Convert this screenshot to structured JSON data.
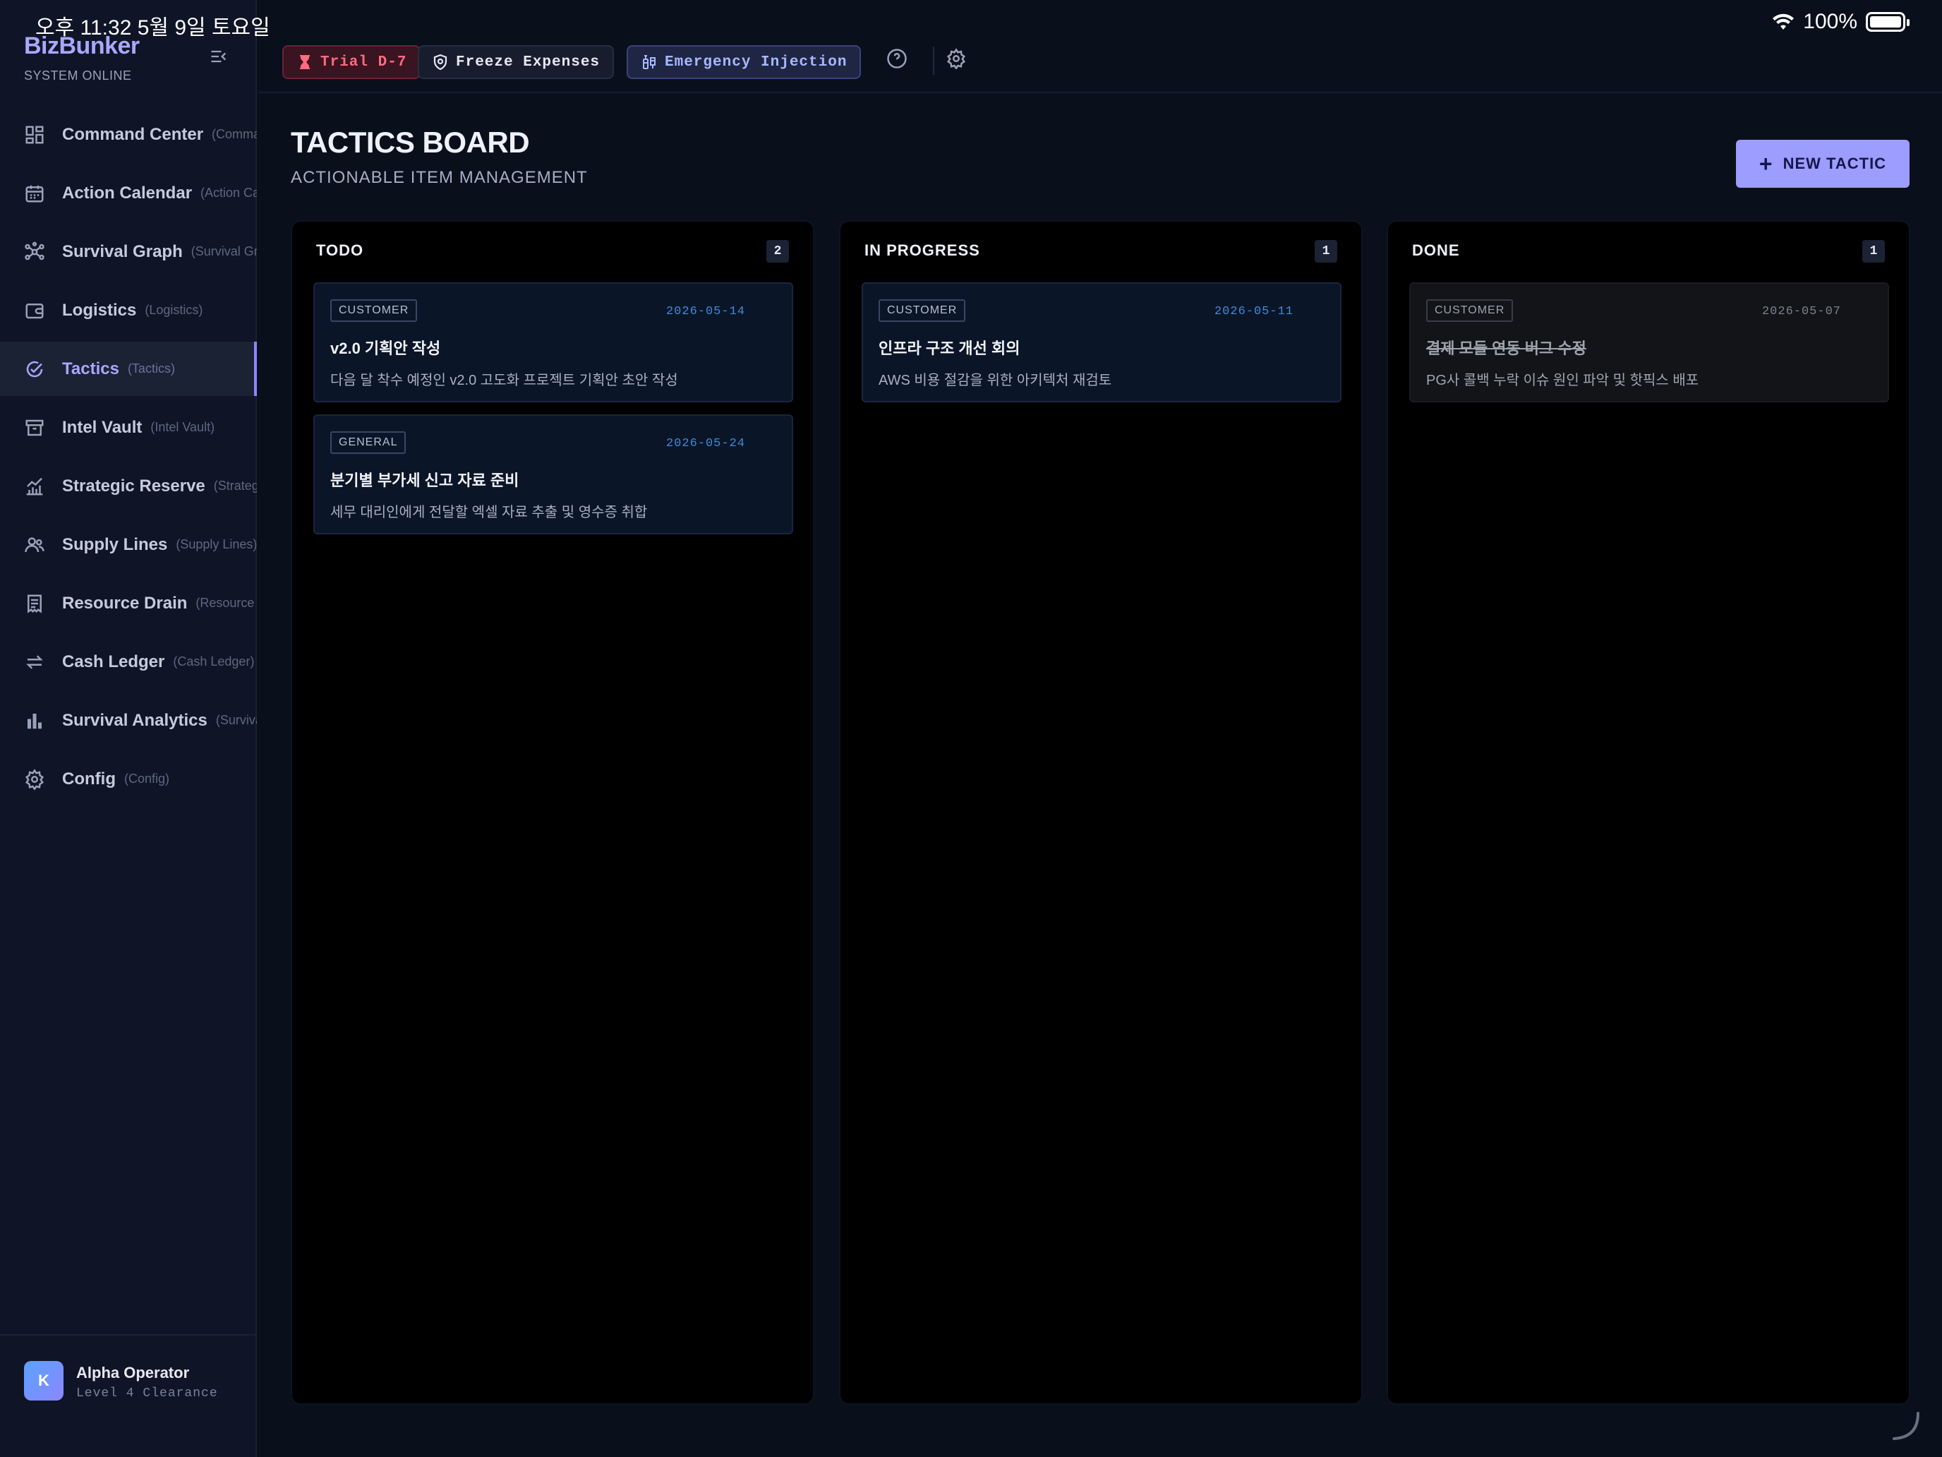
{
  "status_bar": {
    "time": "오후 11:32   5월 9일 토요일",
    "battery": "100%"
  },
  "sidebar": {
    "brand": "BizBunker",
    "status": "SYSTEM ONLINE",
    "items": [
      {
        "label": "Command Center",
        "sub": "(Command Center)",
        "icon": "grid-icon"
      },
      {
        "label": "Action Calendar",
        "sub": "(Action Calendar)",
        "icon": "calendar-icon"
      },
      {
        "label": "Survival Graph",
        "sub": "(Survival Graph)",
        "icon": "graph-icon"
      },
      {
        "label": "Logistics",
        "sub": "(Logistics)",
        "icon": "wallet-icon"
      },
      {
        "label": "Tactics",
        "sub": "(Tactics)",
        "icon": "check-circle-icon",
        "active": true
      },
      {
        "label": "Intel Vault",
        "sub": "(Intel Vault)",
        "icon": "archive-icon"
      },
      {
        "label": "Strategic Reserve",
        "sub": "(Strategic Reserve)",
        "icon": "chart-line-icon"
      },
      {
        "label": "Supply Lines",
        "sub": "(Supply Lines)",
        "icon": "users-icon"
      },
      {
        "label": "Resource Drain",
        "sub": "(Resource Drain)",
        "icon": "receipt-icon"
      },
      {
        "label": "Cash Ledger",
        "sub": "(Cash Ledger)",
        "icon": "swap-icon"
      },
      {
        "label": "Survival Analytics",
        "sub": "(Survival Analytics)",
        "icon": "bar-chart-icon"
      },
      {
        "label": "Config",
        "sub": "(Config)",
        "icon": "gear-icon"
      }
    ],
    "user": {
      "initial": "K",
      "name": "Alpha Operator",
      "level": "Level 4 Clearance"
    }
  },
  "topbar": {
    "trial": "Trial D-7",
    "freeze": "Freeze Expenses",
    "emergency": "Emergency Injection"
  },
  "main": {
    "title": "TACTICS BOARD",
    "subtitle": "ACTIONABLE ITEM MANAGEMENT",
    "new_button": "NEW TACTIC",
    "columns": [
      {
        "title": "TODO",
        "count": "2",
        "cards": [
          {
            "tag": "CUSTOMER",
            "date": "2026-05-14",
            "title": "v2.0 기획안 작성",
            "desc": "다음 달 착수 예정인 v2.0 고도화 프로젝트 기획안 초안 작성"
          },
          {
            "tag": "GENERAL",
            "date": "2026-05-24",
            "title": "분기별 부가세 신고 자료 준비",
            "desc": "세무 대리인에게 전달할 엑셀 자료 추출 및 영수증 취합"
          }
        ]
      },
      {
        "title": "IN PROGRESS",
        "count": "1",
        "cards": [
          {
            "tag": "CUSTOMER",
            "date": "2026-05-11",
            "title": "인프라 구조 개선 회의",
            "desc": "AWS 비용 절감을 위한 아키텍처 재검토"
          }
        ]
      },
      {
        "title": "DONE",
        "count": "1",
        "cards": [
          {
            "tag": "CUSTOMER",
            "date": "2026-05-07",
            "title": "결제 모듈 연동 버그 수정",
            "desc": "PG사 콜백 누락 이슈 원인 파악 및 핫픽스 배포"
          }
        ]
      }
    ]
  },
  "colors": {
    "accent": "#9d9cff",
    "background": "#0a0f1c",
    "sidebar": "#0f1526",
    "date_blue": "#3f8bd6",
    "trial_red": "#ff6b7f"
  }
}
